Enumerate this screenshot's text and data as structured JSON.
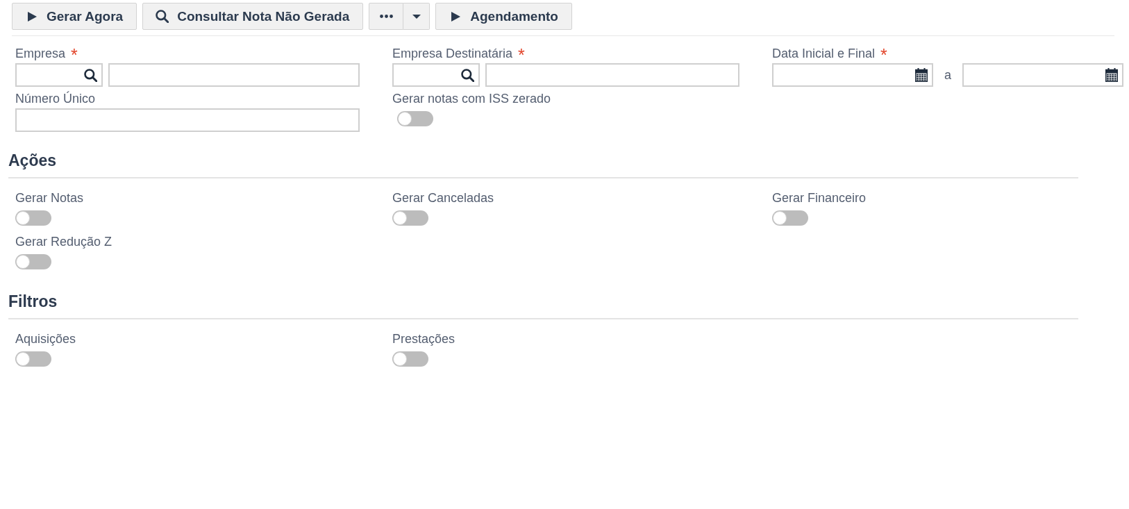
{
  "toolbar": {
    "buttons": [
      {
        "kind": "run",
        "label": "Gerar Agora"
      },
      {
        "kind": "search",
        "label": "Consultar Nota Não Gerada"
      },
      {
        "kind": "more"
      },
      {
        "kind": "run",
        "label": "Agendamento"
      }
    ]
  },
  "form": {
    "fields": [
      {
        "kind": "lookup",
        "label": "Empresa",
        "required_mark": "*"
      },
      {
        "kind": "lookup",
        "label": "Empresa Destinatária",
        "required_mark": "*"
      },
      {
        "kind": "date_range",
        "label": "Data Inicial e Final",
        "required_mark": "*",
        "separator": "a"
      },
      {
        "kind": "text",
        "label": "Número Único"
      },
      {
        "kind": "toggle",
        "label": "Gerar notas com ISS zerado",
        "on": false
      }
    ]
  },
  "sections": [
    {
      "title": "Ações",
      "toggles": [
        {
          "label": "Gerar Notas",
          "on": false
        },
        {
          "label": "Gerar Canceladas",
          "on": false
        },
        {
          "label": "Gerar Financeiro",
          "on": false
        },
        {
          "label": "Gerar Redução Z",
          "on": false
        }
      ]
    },
    {
      "title": "Filtros",
      "toggles": [
        {
          "label": "Aquisições",
          "on": false
        },
        {
          "label": "Prestações",
          "on": false
        }
      ]
    }
  ]
}
